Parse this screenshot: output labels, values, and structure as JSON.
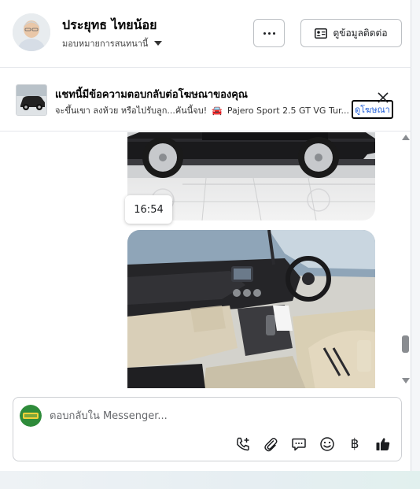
{
  "header": {
    "contact_name": "ประยุทธ ไทยน้อย",
    "assign_label": "มอบหมายการสนทนานี้",
    "contact_info_label": "ดูข้อมูลติดต่อ"
  },
  "ad_banner": {
    "title": "แชทนี้มีข้อความตอบกลับต่อโฆษณาของคุณ",
    "preview_text": "จะขึ้นเขา ลงห้วย หรือไปรับลูก...คันนี้จบ!",
    "ad_name": "Pajero Sport 2.5 GT VG Tur...",
    "view_ad_label": "ดูโฆษณา"
  },
  "chat": {
    "timestamp": "16:54"
  },
  "composer": {
    "placeholder": "ตอบกลับใน Messenger...",
    "baht_symbol": "฿"
  },
  "icons": {
    "more": "more-horizontal-icon",
    "contact_card": "contact-card-icon",
    "close": "close-icon",
    "call": "call-add-icon",
    "attach": "paperclip-icon",
    "saved_replies": "chat-bubble-icon",
    "emoji": "smiley-icon",
    "payment": "baht-icon",
    "like": "thumbs-up-icon"
  },
  "colors": {
    "link": "#1c5bd6",
    "border": "#ced0d4",
    "accent_green": "#2e8b3a"
  }
}
